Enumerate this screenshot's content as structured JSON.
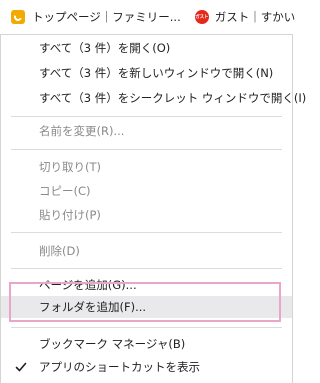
{
  "bookmarks_bar": {
    "items": [
      {
        "label": "トップページ｜ファミリー...",
        "icon": "lemon-favicon-icon"
      },
      {
        "label": "ガスト｜すかいらーくグ...",
        "icon": "gusto-favicon-icon",
        "icon_text": "ガスト"
      }
    ]
  },
  "context_menu": {
    "open_all": "すべて（3 件）を開く(O)",
    "open_all_new_window": "すべて（3 件）を新しいウィンドウで開く(N)",
    "open_all_incognito": "すべて（3 件）をシークレット ウィンドウで開く(I)",
    "rename": "名前を変更(R)...",
    "cut": "切り取り(T)",
    "copy": "コピー(C)",
    "paste": "貼り付け(P)",
    "delete": "削除(D)",
    "add_page": "ページを追加(G)...",
    "add_folder": "フォルダを追加(F)...",
    "bookmark_manager": "ブックマーク マネージャ(B)",
    "show_apps_shortcut": "アプリのショートカットを表示",
    "show_apps_shortcut_checked": true
  },
  "colors": {
    "highlight_border": "#e9a6c9",
    "hover_background": "#e9e9ec",
    "disabled_text": "#8a8a8a"
  }
}
